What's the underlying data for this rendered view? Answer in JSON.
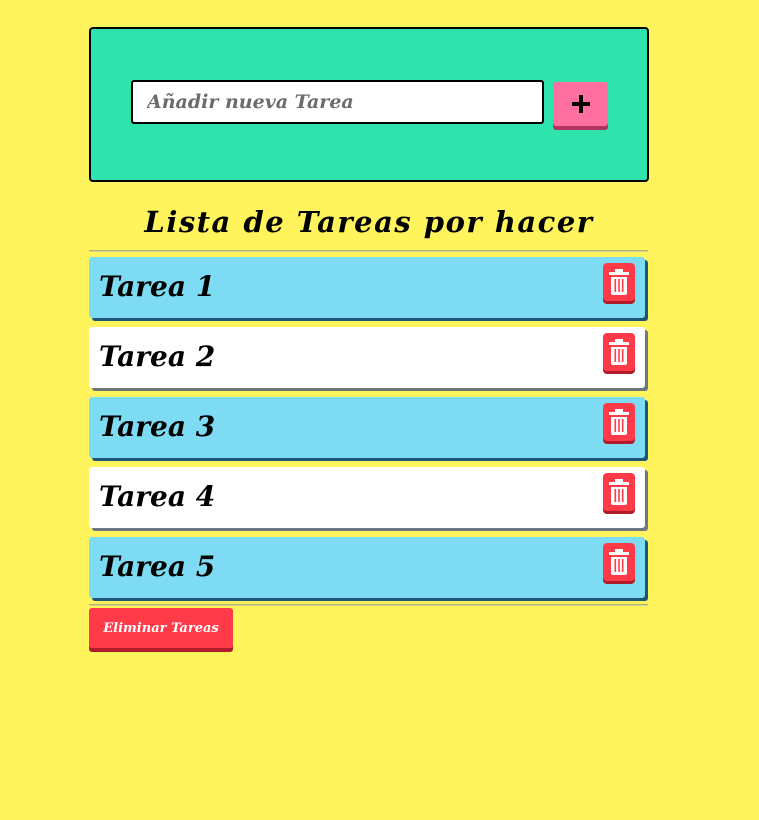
{
  "form": {
    "input_placeholder": "Añadir nueva Tarea",
    "input_value": "",
    "add_label": "+"
  },
  "list": {
    "title": "Lista de Tareas por hacer",
    "tasks": [
      {
        "label": "Tarea 1",
        "style": "blue"
      },
      {
        "label": "Tarea 2",
        "style": "white"
      },
      {
        "label": "Tarea 3",
        "style": "blue"
      },
      {
        "label": "Tarea 4",
        "style": "white"
      },
      {
        "label": "Tarea 5",
        "style": "blue"
      }
    ],
    "delete_icon": "trash-icon"
  },
  "actions": {
    "clear_label": "Eliminar Tareas"
  },
  "colors": {
    "background": "#fff45c",
    "panel": "#2fe3ad",
    "add_button": "#ff6fa0",
    "task_blue": "#7ddcf3",
    "task_white": "#ffffff",
    "delete": "#ff3b4a"
  }
}
